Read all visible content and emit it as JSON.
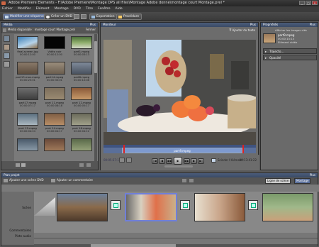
{
  "window": {
    "title": "Adobe Premiere Elements - F:\\Adobe Premiere\\Montage DPS all files\\Montage Adobe donne\\montage court Montage.prel *"
  },
  "menu": [
    "Fichier",
    "Modifier",
    "Elément",
    "Montage",
    "DVD",
    "Titre",
    "Fenêtre",
    "Aide"
  ],
  "toolbar": {
    "edit_sequence": "Modifier une séquence",
    "create_dvd": "Créer un DVD",
    "export": "Exportation",
    "procedure": "Procédure"
  },
  "media_panel": {
    "title": "Média",
    "more": "Plus",
    "subtitle": "Média disponible : montage court Montage.prel",
    "close": "Fermer",
    "items": [
      {
        "name": "final-screen.jpg",
        "duration": "00:00:12:00"
      },
      {
        "name": "Vidéo noir",
        "duration": "00:00:12:00"
      },
      {
        "name": "part1.mpeg",
        "duration": "00:00:03:13"
      },
      {
        "name": "part13.mov.mpeg",
        "duration": "00:00:25:01"
      },
      {
        "name": "part14.mpeg",
        "duration": "00:00:33:01"
      },
      {
        "name": "part8.mpeg",
        "duration": "00:00:10:08"
      },
      {
        "name": "part17.mpeg",
        "duration": "00:00:07:17"
      },
      {
        "name": "part 11.mpeg",
        "duration": "00:00:08:18"
      },
      {
        "name": "part 12.mpeg",
        "duration": "00:00:05:17"
      },
      {
        "name": "part 15.mpeg",
        "duration": "00:00:04:24"
      },
      {
        "name": "part 14.mpeg",
        "duration": "00:00:04:17"
      },
      {
        "name": "part 16.mpeg",
        "duration": "00:00:04:12"
      },
      {
        "name": "",
        "duration": ""
      },
      {
        "name": "",
        "duration": ""
      },
      {
        "name": "",
        "duration": ""
      }
    ]
  },
  "monitor": {
    "title": "Moniteur",
    "more": "Plus",
    "add_text": "Ajouter du texte",
    "clip_name": "part9.mpeg",
    "timecode_left": "00:05:37:10",
    "timecode_right": "00:13:41:22",
    "split_clip": "Scinder l'élément"
  },
  "properties": {
    "title": "Propriétés",
    "more": "Plus",
    "hint": "Afficher les images clés",
    "clip_name": "part9.mpeg",
    "clip_duration": "00:00:15:13",
    "clip_type": "Elément vidéo",
    "rows": [
      "Trajecto...",
      "Opacité"
    ]
  },
  "timeline": {
    "title": "Plan projet",
    "more": "Plus",
    "add_dvd_scene": "Ajouter une scène DVD",
    "add_comment": "Ajouter un commentaire",
    "tab_scene": "Ligne de scène",
    "tab_montage": "Montage",
    "tracks": [
      "Scène",
      "Commentaires",
      "Piste audio"
    ]
  },
  "colors": {
    "accent": "#4b5c7a",
    "selection": "#d7a300"
  }
}
